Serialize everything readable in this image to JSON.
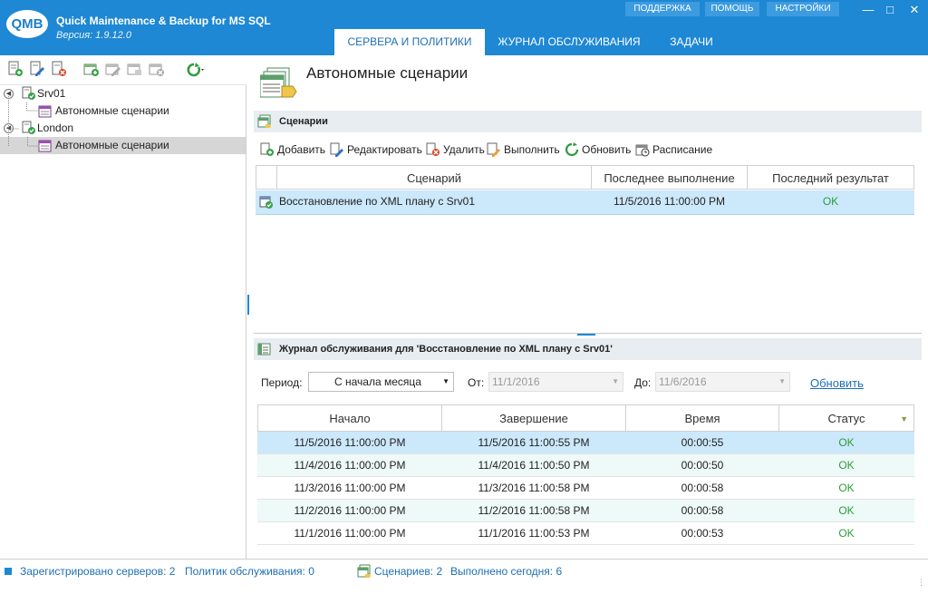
{
  "app": {
    "title": "Quick Maintenance & Backup for MS SQL",
    "version": "Версия: 1.9.12.0",
    "logo": "QMB"
  },
  "top_buttons": [
    "ПОДДЕРЖКА",
    "ПОМОЩЬ",
    "НАСТРОЙКИ"
  ],
  "tabs": [
    "СЕРВЕРА И ПОЛИТИКИ",
    "ЖУРНАЛ ОБСЛУЖИВАНИЯ",
    "ЗАДАЧИ"
  ],
  "tree": {
    "servers": [
      {
        "name": "Srv01",
        "child": "Автономные сценарии"
      },
      {
        "name": "London",
        "child": "Автономные сценарии"
      }
    ]
  },
  "page": {
    "title": "Автономные сценарии"
  },
  "scenarios": {
    "header": "Сценарии",
    "actions": [
      "Добавить",
      "Редактировать",
      "Удалить",
      "Выполнить",
      "Обновить",
      "Расписание"
    ],
    "columns": [
      "Сценарий",
      "Последнее выполнение",
      "Последний результат"
    ],
    "rows": [
      {
        "name": "Восстановление по XML плану с Srv01",
        "last_run": "11/5/2016 11:00:00 PM",
        "result": "OK"
      }
    ]
  },
  "journal": {
    "header": "Журнал обслуживания для 'Восстановление по XML плану с Srv01'",
    "period_label": "Период:",
    "period_value": "С начала месяца",
    "from_label": "От:",
    "from_value": "11/1/2016",
    "to_label": "До:",
    "to_value": "11/6/2016",
    "refresh": "Обновить",
    "columns": [
      "Начало",
      "Завершение",
      "Время",
      "Статус"
    ],
    "rows": [
      {
        "start": "11/5/2016 11:00:00 PM",
        "end": "11/5/2016 11:00:55 PM",
        "time": "00:00:55",
        "status": "OK"
      },
      {
        "start": "11/4/2016 11:00:00 PM",
        "end": "11/4/2016 11:00:50 PM",
        "time": "00:00:50",
        "status": "OK"
      },
      {
        "start": "11/3/2016 11:00:00 PM",
        "end": "11/3/2016 11:00:58 PM",
        "time": "00:00:58",
        "status": "OK"
      },
      {
        "start": "11/2/2016 11:00:00 PM",
        "end": "11/2/2016 11:00:58 PM",
        "time": "00:00:58",
        "status": "OK"
      },
      {
        "start": "11/1/2016 11:00:00 PM",
        "end": "11/1/2016 11:00:53 PM",
        "time": "00:00:53",
        "status": "OK"
      }
    ]
  },
  "status": {
    "servers": "Зарегистрировано серверов: 2",
    "policies": "Политик обслуживания: 0",
    "scenarios": "Сценариев: 2",
    "done_today": "Выполнено сегодня: 6"
  },
  "colors": {
    "accent": "#1e88d4",
    "selection": "#cce8fb",
    "ok": "#2a9d3a"
  }
}
